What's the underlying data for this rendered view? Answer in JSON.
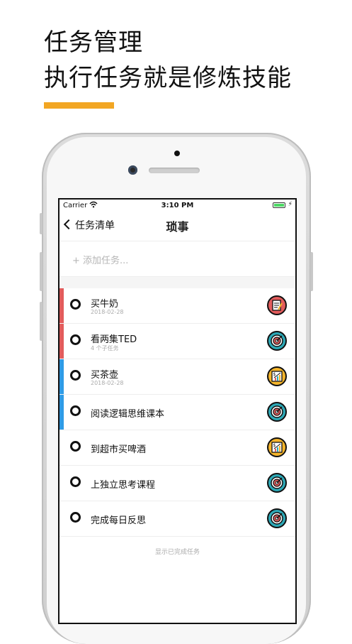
{
  "promo": {
    "line1": "任务管理",
    "line2": "执行任务就是修炼技能",
    "accent_color": "#F2A623"
  },
  "status_bar": {
    "carrier": "Carrier",
    "time": "3:10 PM"
  },
  "nav": {
    "back_label": "任务清单",
    "title": "琐事"
  },
  "add_task": {
    "placeholder": "+ 添加任务..."
  },
  "tasks": [
    {
      "title": "买牛奶",
      "subtitle": "2018-02-28",
      "stripe": "#E25C5C",
      "icon": "notepad-icon",
      "badge": "red"
    },
    {
      "title": "看两集TED",
      "subtitle": "4 个子任务",
      "stripe": "#E25C5C",
      "icon": "target-icon",
      "badge": "teal"
    },
    {
      "title": "买茶壶",
      "subtitle": "2018-02-28",
      "stripe": "#2E9BE6",
      "icon": "finance-chart-icon",
      "badge": "yellow"
    },
    {
      "title": "阅读逻辑思维课本",
      "subtitle": "",
      "stripe": "#2E9BE6",
      "icon": "target-icon",
      "badge": "teal"
    },
    {
      "title": "到超市买啤酒",
      "subtitle": "",
      "stripe": "",
      "icon": "finance-chart-icon",
      "badge": "yellow"
    },
    {
      "title": "上独立思考课程",
      "subtitle": "",
      "stripe": "",
      "icon": "target-icon",
      "badge": "teal"
    },
    {
      "title": "完成每日反思",
      "subtitle": "",
      "stripe": "",
      "icon": "target-icon",
      "badge": "teal"
    }
  ],
  "footer": {
    "show_completed": "显示已完成任务"
  }
}
